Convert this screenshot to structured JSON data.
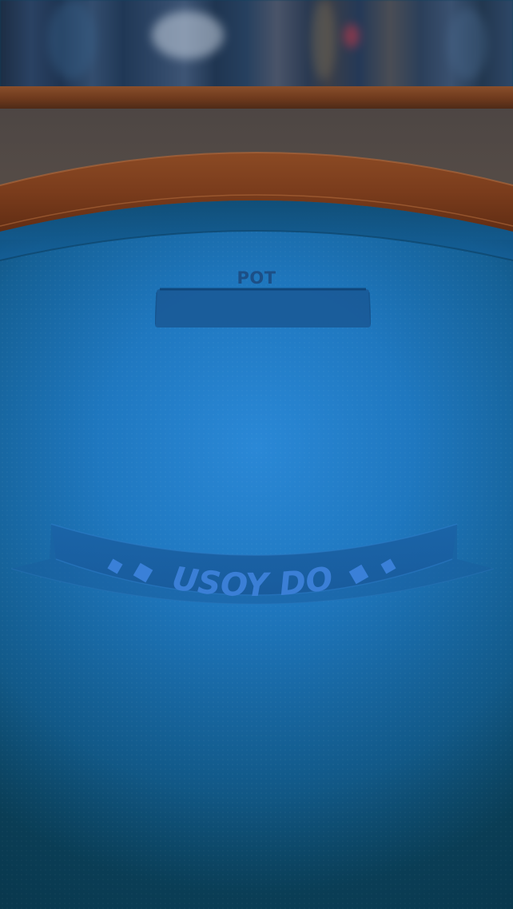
{
  "table": {
    "pot_label": "POT",
    "pot_value": "",
    "game_title": "PUSOY DOS"
  },
  "colors": {
    "felt_center": "#2a86d2",
    "felt_edge": "#0c4660",
    "rail": "#7a3c1c",
    "banner": "#1b5f9e",
    "banner_text": "#3b7fd6",
    "pot_text": "#1c4f86"
  },
  "icons": {
    "banner_ornament": "diamond-icon"
  }
}
